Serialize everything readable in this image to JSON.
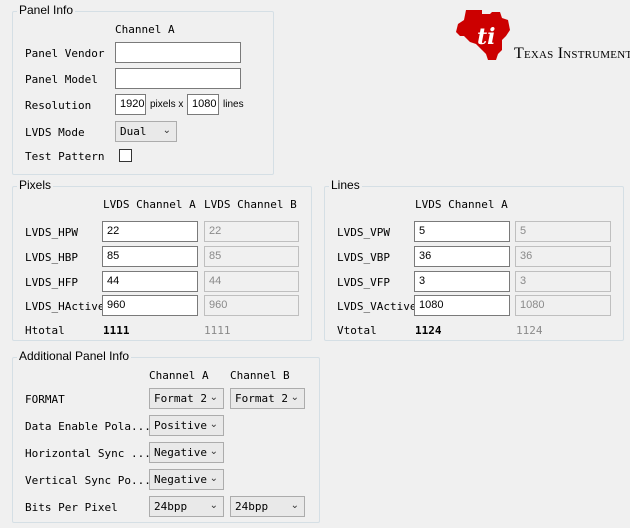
{
  "panel_info": {
    "title": "Panel Info",
    "channel_header": "Channel A",
    "vendor_label": "Panel Vendor",
    "vendor_value": "",
    "model_label": "Panel Model",
    "model_value": "",
    "resolution_label": "Resolution",
    "res_width": "1920",
    "res_pixels_x": "pixels x",
    "res_height": "1080",
    "res_lines": "lines",
    "lvds_mode_label": "LVDS Mode",
    "lvds_mode_value": "Dual",
    "test_pattern_label": "Test Pattern",
    "test_pattern_checked": false
  },
  "logo": {
    "text": "Texas Instruments",
    "color": "#cc0000"
  },
  "pixels": {
    "title": "Pixels",
    "header_a": "LVDS Channel A",
    "header_b": "LVDS Channel B",
    "rows": [
      {
        "label": "LVDS_HPW",
        "a": "22",
        "b": "22"
      },
      {
        "label": "LVDS_HBP",
        "a": "85",
        "b": "85"
      },
      {
        "label": "LVDS_HFP",
        "a": "44",
        "b": "44"
      },
      {
        "label": "LVDS_HActive",
        "a": "960",
        "b": "960"
      }
    ],
    "total_label": "Htotal",
    "total_a": "1111",
    "total_b": "1111"
  },
  "lines": {
    "title": "Lines",
    "header_a": "LVDS Channel A",
    "rows": [
      {
        "label": "LVDS_VPW",
        "a": "5",
        "b": "5"
      },
      {
        "label": "LVDS_VBP",
        "a": "36",
        "b": "36"
      },
      {
        "label": "LVDS_VFP",
        "a": "3",
        "b": "3"
      },
      {
        "label": "LVDS_VActive",
        "a": "1080",
        "b": "1080"
      }
    ],
    "total_label": "Vtotal",
    "total_a": "1124",
    "total_b": "1124"
  },
  "additional": {
    "title": "Additional Panel Info",
    "header_a": "Channel A",
    "header_b": "Channel B",
    "rows": [
      {
        "label": "FORMAT",
        "a": "Format 2",
        "b": "Format 2"
      },
      {
        "label": "Data Enable Pola...",
        "a": "Positive"
      },
      {
        "label": "Horizontal Sync ...",
        "a": "Negative"
      },
      {
        "label": "Vertical Sync Po...",
        "a": "Negative"
      },
      {
        "label": "Bits Per Pixel",
        "a": "24bpp",
        "b": "24bpp"
      }
    ]
  }
}
